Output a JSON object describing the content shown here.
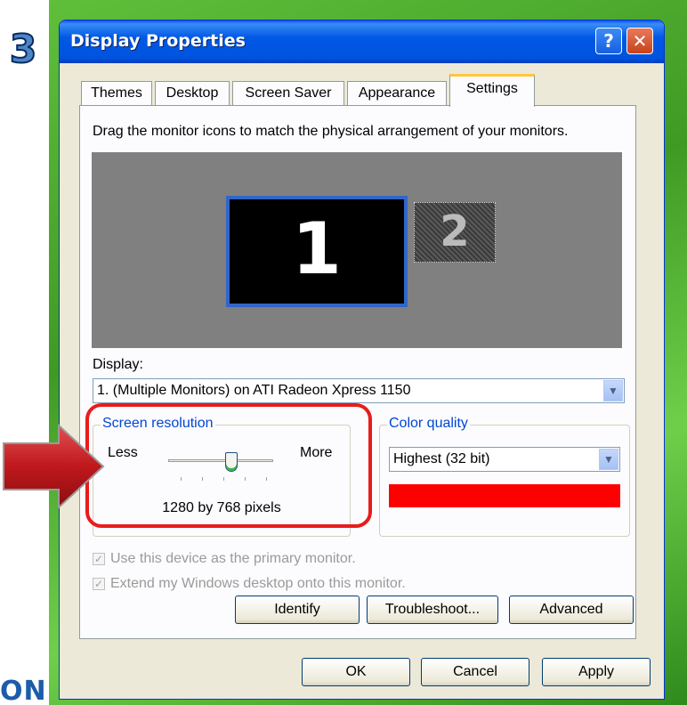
{
  "step_number": "3",
  "brand_fragment": "ON",
  "window": {
    "title": "Display Properties",
    "help_label": "?",
    "close_label": "✕"
  },
  "tabs": [
    {
      "label": "Themes"
    },
    {
      "label": "Desktop"
    },
    {
      "label": "Screen Saver"
    },
    {
      "label": "Appearance"
    },
    {
      "label": "Settings",
      "active": true
    }
  ],
  "settings": {
    "instruction": "Drag the monitor icons to match the physical arrangement of your monitors.",
    "monitors": [
      {
        "label": "1",
        "selected": true
      },
      {
        "label": "2",
        "selected": false
      }
    ],
    "display_label": "Display:",
    "display_value": "1. (Multiple Monitors) on ATI Radeon Xpress 1150",
    "screen_resolution": {
      "legend": "Screen resolution",
      "less_label": "Less",
      "more_label": "More",
      "slider_fraction": 0.6,
      "value_text": "1280 by 768 pixels"
    },
    "color_quality": {
      "legend": "Color quality",
      "value": "Highest (32 bit)"
    },
    "checkboxes": [
      {
        "label": "Use this device as the primary monitor.",
        "checked": true,
        "enabled": false
      },
      {
        "label": "Extend my Windows desktop onto this monitor.",
        "checked": true,
        "enabled": false
      }
    ],
    "buttons": {
      "identify": "Identify",
      "troubleshoot": "Troubleshoot...",
      "advanced": "Advanced"
    }
  },
  "dialog_buttons": {
    "ok": "OK",
    "cancel": "Cancel",
    "apply": "Apply"
  },
  "colors": {
    "highlight": "#e81c1c",
    "arrow": "#c0181c",
    "titlebar": "#0058e6",
    "active_tab_accent": "#ffc83c"
  }
}
